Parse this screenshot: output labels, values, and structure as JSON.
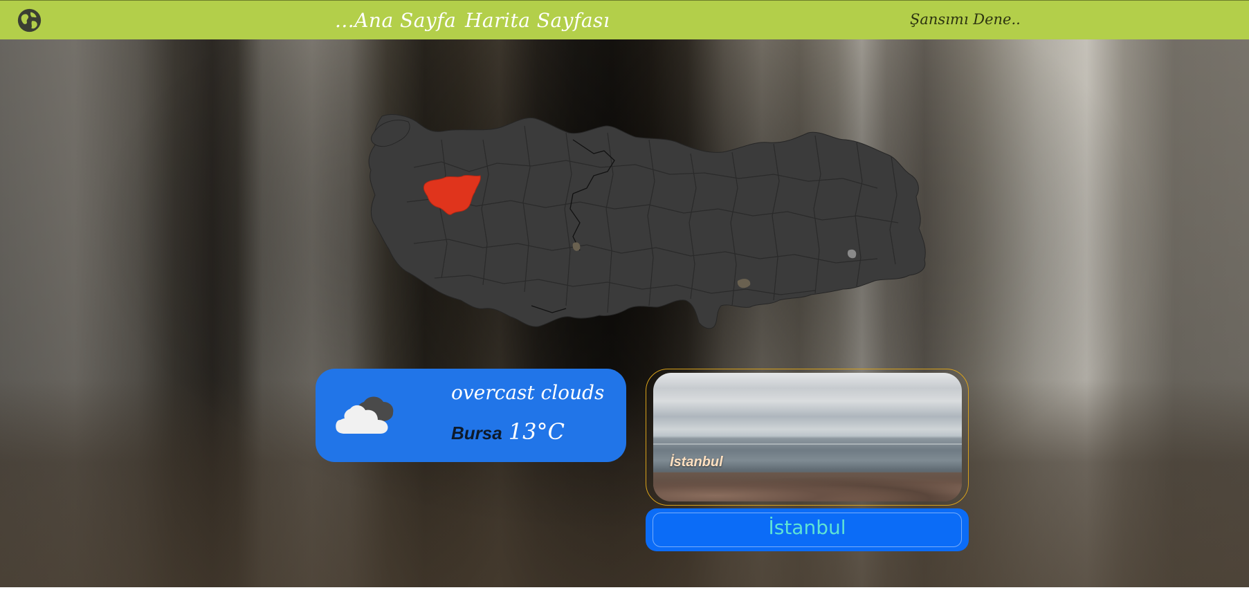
{
  "navbar": {
    "logo_icon": "globe-icon",
    "home_label": "...Ana Sayfa",
    "map_label": "Harita Sayfası",
    "luck_label": "Şansımı Dene.."
  },
  "map": {
    "highlighted_province": "Bursa",
    "highlight_color": "#e0341c",
    "base_color": "#3b3b3b"
  },
  "weather": {
    "icon": "cloud-icon",
    "description": "overcast clouds",
    "city": "Bursa",
    "temperature": "13°C"
  },
  "photo": {
    "caption": "İstanbul"
  },
  "city_button": {
    "label": "İstanbul"
  },
  "colors": {
    "navbar": "#b3cf4a",
    "weather_card": "#2175e8",
    "button": "#0b6cf7",
    "button_text": "#5fe3d4",
    "photo_border": "#d9a21a"
  }
}
